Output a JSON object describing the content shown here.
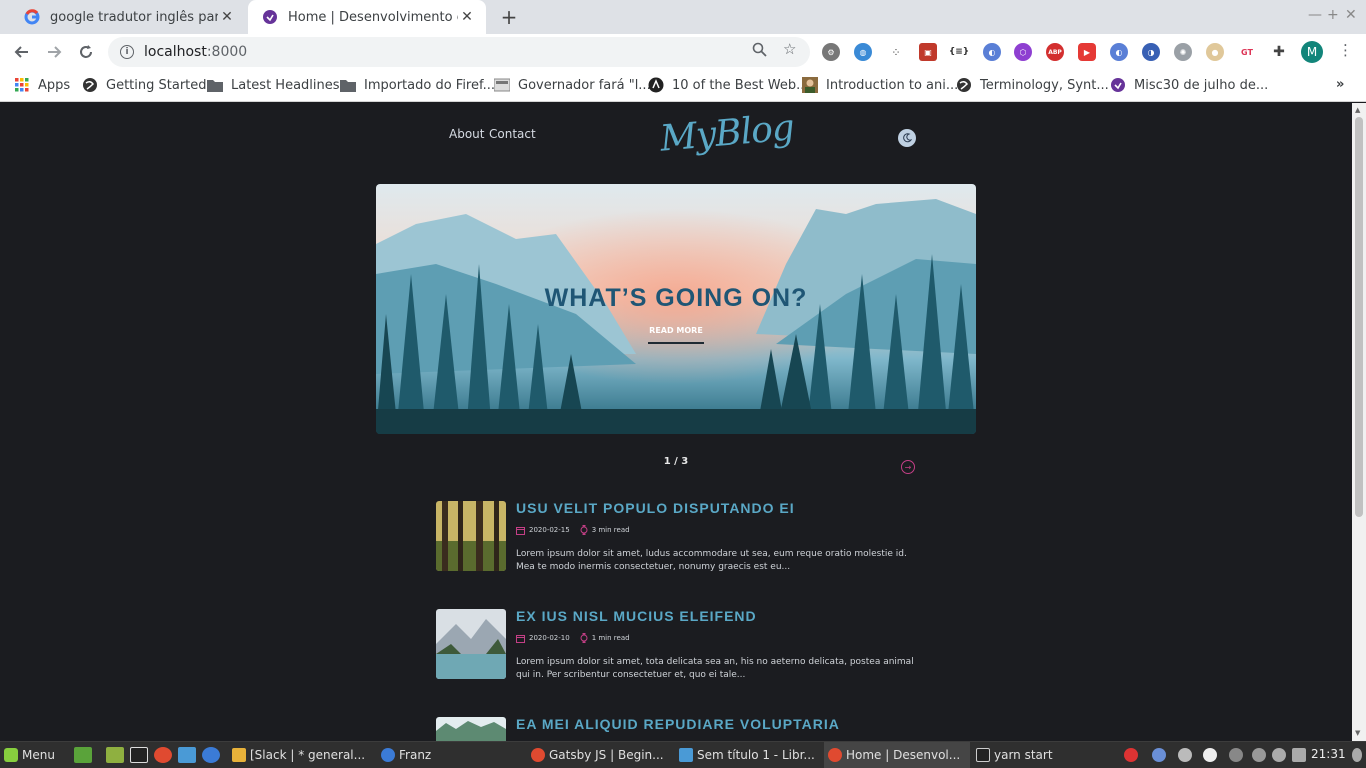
{
  "browser": {
    "tabs": [
      {
        "title": "google tradutor inglês para por",
        "active": false,
        "favicon": "google-icon"
      },
      {
        "title": "Home | Desenvolvimento é mir",
        "active": true,
        "favicon": "gatsby-icon"
      }
    ],
    "address": {
      "host": "localhost",
      "port": ":8000"
    },
    "profile_initial": "M"
  },
  "bookmarks": [
    {
      "label": "Apps",
      "icon": "apps-grid-icon"
    },
    {
      "label": "Getting Started",
      "icon": "globe-icon"
    },
    {
      "label": "Latest Headlines",
      "icon": "folder-icon"
    },
    {
      "label": "Importado do Firef...",
      "icon": "folder-icon"
    },
    {
      "label": "Governador fará \"l...",
      "icon": "news-icon"
    },
    {
      "label": "10 of the Best Web...",
      "icon": "site-icon"
    },
    {
      "label": "Introduction to ani...",
      "icon": "avatar-icon"
    },
    {
      "label": "Terminology, Synt...",
      "icon": "globe-icon"
    },
    {
      "label": "Misc30 de julho de...",
      "icon": "gatsby-icon"
    }
  ],
  "site": {
    "nav": [
      "About",
      "Contact"
    ],
    "logo": "MyBlog",
    "theme_toggle_icon": "moon-icon"
  },
  "hero": {
    "title": "WHAT’S GOING ON?",
    "cta": "READ MORE",
    "pager": "1 / 3"
  },
  "posts": [
    {
      "title": "USU VELIT POPULO DISPUTANDO EI",
      "date": "2020-02-15",
      "read": "3 min read",
      "excerpt": "Lorem ipsum dolor sit amet, ludus accommodare ut sea, eum reque oratio molestie id. Mea te modo inermis consectetuer, nonumy graecis est eu..."
    },
    {
      "title": "EX IUS NISL MUCIUS ELEIFEND",
      "date": "2020-02-10",
      "read": "1 min read",
      "excerpt": "Lorem ipsum dolor sit amet, tota delicata sea an, his no aeterno delicata, postea animal qui in. Per scribentur consectetuer et, quo ei tale..."
    },
    {
      "title": "EA MEI ALIQUID REPUDIARE VOLUPTARIA",
      "date": "",
      "read": "",
      "excerpt": ""
    }
  ],
  "taskbar": {
    "menu": "Menu",
    "windows": [
      {
        "label": "[Slack | * general...",
        "active": false
      },
      {
        "label": "Franz",
        "active": false
      },
      {
        "label": "Gatsby JS | Begin...",
        "active": false
      },
      {
        "label": "Sem título 1 - Libr...",
        "active": false
      },
      {
        "label": "Home | Desenvol...",
        "active": true
      },
      {
        "label": "yarn start",
        "active": false
      }
    ],
    "clock": "21:31"
  },
  "colors": {
    "page_bg": "#1b1c20",
    "accent_blue": "#5aa8c6",
    "accent_pink": "#c43f86",
    "hero_title": "#1f5675"
  }
}
